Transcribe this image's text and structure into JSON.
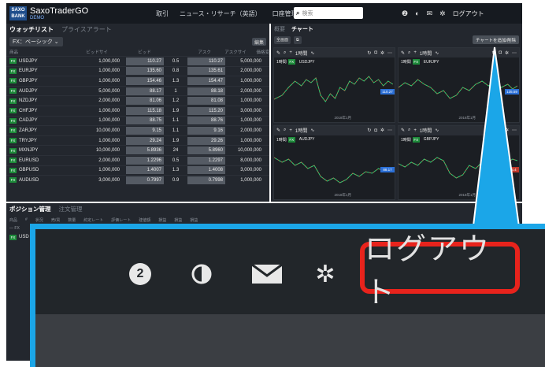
{
  "header": {
    "logo_text": "SAXO BANK",
    "app_name": "SaxoTraderGO",
    "demo_label": "DEMO",
    "nav": [
      "取引",
      "ニュース・リサーチ（英語）",
      "口座管理"
    ],
    "search_placeholder": "検索",
    "logout_label": "ログアウト",
    "help_badge": "2"
  },
  "watchlist": {
    "tab_active": "ウォッチリスト",
    "tab_inactive": "プライスアラート",
    "dropdown_value": "FX：ベーシック",
    "edit_label": "編集",
    "columns": [
      "商品",
      "ビッドサイ",
      "ビッド",
      "",
      "アスク",
      "アスクサイ",
      "価格変"
    ],
    "rows": [
      {
        "badge": "FX",
        "symbol": "USDJPY",
        "qty": "1,000,000",
        "bid": "110.27",
        "spread": "0.5",
        "ask": "110.27",
        "ask_qty": "5,000,000"
      },
      {
        "badge": "FX",
        "symbol": "EURJPY",
        "qty": "1,000,000",
        "bid": "135.60",
        "spread": "0.8",
        "ask": "135.61",
        "ask_qty": "2,000,000"
      },
      {
        "badge": "FX",
        "symbol": "GBPJPY",
        "qty": "1,000,000",
        "bid": "154.46",
        "spread": "1.3",
        "ask": "154.47",
        "ask_qty": "1,000,000"
      },
      {
        "badge": "FX",
        "symbol": "AUDJPY",
        "qty": "5,000,000",
        "bid": "88.17",
        "spread": "1",
        "ask": "88.18",
        "ask_qty": "2,000,000"
      },
      {
        "badge": "FX",
        "symbol": "NZDJPY",
        "qty": "2,000,000",
        "bid": "81.06",
        "spread": "1.2",
        "ask": "81.08",
        "ask_qty": "1,000,000"
      },
      {
        "badge": "FX",
        "symbol": "CHFJPY",
        "qty": "1,000,000",
        "bid": "115.18",
        "spread": "1.9",
        "ask": "115.20",
        "ask_qty": "3,000,000"
      },
      {
        "badge": "FX",
        "symbol": "CADJPY",
        "qty": "1,000,000",
        "bid": "88.75",
        "spread": "1.1",
        "ask": "88.76",
        "ask_qty": "1,000,000"
      },
      {
        "badge": "FX",
        "symbol": "ZARJPY",
        "qty": "10,000,000",
        "bid": "9.15",
        "spread": "1.1",
        "ask": "9.16",
        "ask_qty": "2,000,000"
      },
      {
        "badge": "FX",
        "symbol": "TRYJPY",
        "qty": "1,000,000",
        "bid": "29.24",
        "spread": "1.9",
        "ask": "29.26",
        "ask_qty": "1,000,000"
      },
      {
        "badge": "FX",
        "symbol": "MXNJPY",
        "qty": "10,000,000",
        "bid": "5.8936",
        "spread": "24",
        "ask": "5.8960",
        "ask_qty": "10,000,000"
      },
      {
        "badge": "FX",
        "symbol": "EURUSD",
        "qty": "2,000,000",
        "bid": "1.2296",
        "spread": "0.5",
        "ask": "1.2297",
        "ask_qty": "8,000,000"
      },
      {
        "badge": "FX",
        "symbol": "GBPUSD",
        "qty": "1,000,000",
        "bid": "1.4007",
        "spread": "1.3",
        "ask": "1.4008",
        "ask_qty": "3,000,000"
      },
      {
        "badge": "FX",
        "symbol": "AUDUSD",
        "qty": "3,000,000",
        "bid": "0.7997",
        "spread": "0.9",
        "ask": "0.7998",
        "ask_qty": "1,000,000"
      }
    ]
  },
  "charts_panel": {
    "tab_inactive": "概要",
    "tab_active": "チャート",
    "fullscreen_label": "全画面",
    "add_chart_label": "チャートを追加/削除",
    "charts": [
      {
        "label": "1時間",
        "badge": "FX",
        "symbol": "USDJPY",
        "price_tag": "110.27",
        "tag_color": "#2b6fd6",
        "date_label": "2018年1月"
      },
      {
        "label": "1時間",
        "badge": "FX",
        "symbol": "EURJPY",
        "price_tag": "135.59",
        "tag_color": "#2b6fd6",
        "date_label": "2018年1月"
      },
      {
        "label": "1時間",
        "badge": "FX",
        "symbol": "AUDJPY",
        "price_tag": "88.17",
        "tag_color": "#2b6fd6",
        "date_label": "2018年1月"
      },
      {
        "label": "1時間",
        "badge": "FX",
        "symbol": "GBPJPY",
        "price_tag": "154.4",
        "tag_color": "#c0392b",
        "date_label": "2018年1月"
      }
    ]
  },
  "positions": {
    "tab_active": "ポジション管理",
    "tab_inactive": "注文管理",
    "columns": [
      "商品",
      "#",
      "状況",
      "売/買",
      "数量",
      "約定レート",
      "評価レート",
      "建値額",
      "損益",
      "損益",
      "損益"
    ],
    "group_label": "— FX",
    "row_badge": "FX",
    "row_symbol": "USD"
  },
  "zoom": {
    "help_badge": "2",
    "logout_label": "ログアウト",
    "highlight_color": "#e8231c",
    "frame_color": "#1ba6e8"
  }
}
